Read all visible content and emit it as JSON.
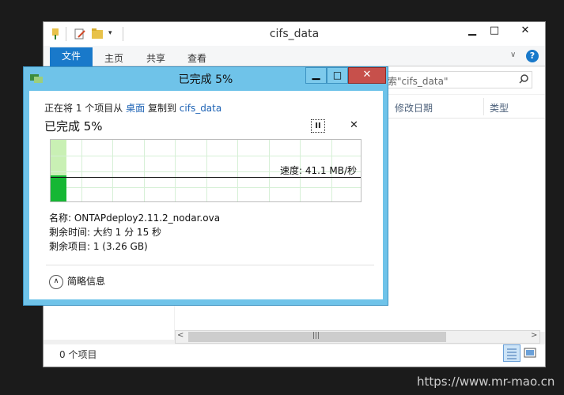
{
  "explorer": {
    "title": "cifs_data",
    "ribbon_tabs": [
      "文件",
      "主页",
      "共享",
      "查看"
    ],
    "search_placeholder": "索\"cifs_data\"",
    "columns": [
      "修改日期",
      "类型"
    ],
    "status_count": "0 个项目",
    "caption_min": "▁",
    "caption_max": "□",
    "caption_close": "✕",
    "help": "?",
    "ribbon_chevron": "∨"
  },
  "dialog": {
    "title": "已完成 5%",
    "copy_prefix": "正在将 1 个项目从",
    "source": "桌面",
    "copy_mid": "复制到",
    "destination": "cifs_data",
    "percent_label": "已完成 5%",
    "progress_fraction": 0.05,
    "speed": "速度: 41.1 MB/秒",
    "name_line": "名称: ONTAPdeploy2.11.2_nodar.ova",
    "time_line": "剩余时间: 大约 1 分 15 秒",
    "items_line": "剩余项目: 1 (3.26 GB)",
    "details_label": "简略信息",
    "pause_glyph": "II",
    "close_glyph": "✕",
    "min_glyph": "▁",
    "max_glyph": "□"
  },
  "watermark": "https://www.mr-mao.cn",
  "colors": {
    "dialog_frame": "#6fc3e9",
    "close_button": "#c7504b",
    "accent": "#1979ca",
    "progress_green": "#16b734",
    "progress_light": "#c9f0b4"
  }
}
